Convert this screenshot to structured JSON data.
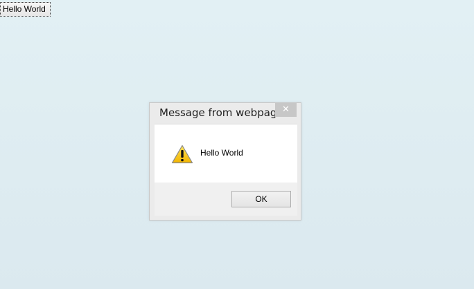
{
  "page": {
    "button_label": "Hello World"
  },
  "dialog": {
    "title": "Message from webpage",
    "close_glyph": "✕",
    "message": "Hello World",
    "ok_label": "OK",
    "icon": "warning-icon"
  },
  "colors": {
    "warning_yellow": "#f6c200",
    "background": "#dfeef2"
  }
}
